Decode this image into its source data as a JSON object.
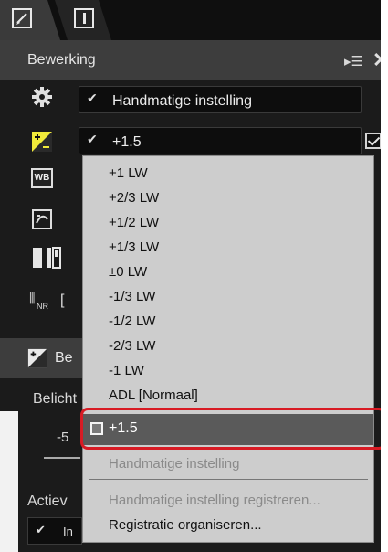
{
  "tabs": [
    {
      "name": "edit-tab",
      "icon": "edit-icon"
    },
    {
      "name": "info-tab",
      "icon": "info-icon"
    }
  ],
  "panel": {
    "title": "Bewerking",
    "menu_icon": "▸☰",
    "close_icon": "✕"
  },
  "rows": {
    "settings": {
      "icon": "gear-icon",
      "value": "Handmatige instelling"
    },
    "exposure": {
      "icon": "exposure-comp-icon",
      "value": "+1.5",
      "checked": true
    }
  },
  "side_icons": [
    "wb-icon",
    "picture-control-icon",
    "levels-icon",
    "noise-reduction-icon"
  ],
  "wb_label": "WB",
  "nr_label": "NR",
  "subpanel": {
    "title": "Be",
    "label": "Belicht",
    "slider_min": "-5",
    "active_label": "Actiev",
    "active_value": "In"
  },
  "dropdown": {
    "items": [
      "+1 LW",
      "+2/3 LW",
      "+1/2 LW",
      "+1/3 LW",
      "±0 LW",
      "-1/3 LW",
      "-1/2 LW",
      "-2/3 LW",
      "-1 LW",
      "ADL [Normaal]"
    ],
    "selected": "+1.5",
    "manual": "Handmatige instelling",
    "register": "Handmatige instelling registreren...",
    "organize": "Registratie organiseren..."
  },
  "colors": {
    "highlight": "#d81b24",
    "panel_bg": "#1b1b1b",
    "list_bg": "#cdcdcd"
  }
}
